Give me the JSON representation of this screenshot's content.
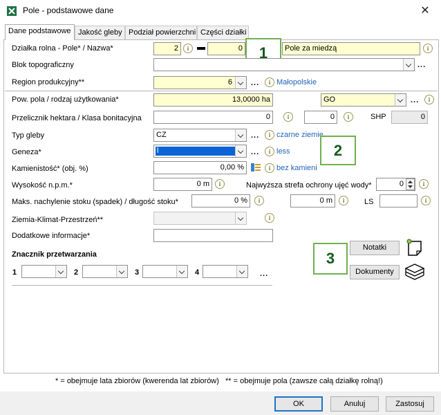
{
  "window": {
    "title": "Pole - podstawowe dane",
    "close_glyph": "✕"
  },
  "tabs": [
    {
      "label": "Dane podstawowe",
      "active": true
    },
    {
      "label": "Jakość gleby",
      "active": false
    },
    {
      "label": "Podział powierzchni",
      "active": false
    },
    {
      "label": "Części działki",
      "active": false
    }
  ],
  "form": {
    "dzialka": {
      "label": "Działka rolna - Pole* / Nazwa*",
      "value1": "2",
      "value2": "0",
      "name_value": "Pole za miedzą"
    },
    "blok": {
      "label": "Blok topograficzny",
      "value": ""
    },
    "region": {
      "label": "Region produkcyjny**",
      "value": "6",
      "link": "Małopolskie"
    },
    "pow": {
      "label": "Pow. pola / rodzaj użytkowania*",
      "value": "13,0000 ha",
      "usage_value": "GO"
    },
    "przelicznik": {
      "label": "Przelicznik hektara / Klasa bonitacyjna",
      "value1": "0",
      "value2": "0",
      "shp_label": "SHP",
      "shp_value": "0"
    },
    "typ_gleby": {
      "label": "Typ gleby",
      "value": "CZ",
      "link": "czarne ziemie"
    },
    "geneza": {
      "label": "Geneza*",
      "value": "l",
      "link": "less"
    },
    "kamienistosc": {
      "label": "Kamienistość* (obj. %)",
      "value": "0,00 %",
      "link": "bez kamieni"
    },
    "wysokosc": {
      "label": "Wysokość n.p.m.*",
      "value": "0 m"
    },
    "strefa": {
      "label": "Najwyższa strefa ochrony ujęć wody*",
      "value": "0"
    },
    "nachylenie": {
      "label": "Maks. nachylenie stoku (spadek) / długość stoku*",
      "value1": "0 %",
      "value2": "0 m",
      "ls_label": "LS",
      "ls_value": ""
    },
    "zkp": {
      "label": "Ziemia-Klimat-Przestrzeń**",
      "value": ""
    },
    "dodatkowe": {
      "label": "Dodatkowe informacje*",
      "value": ""
    }
  },
  "znacznik": {
    "title": "Znacznik przetwarzania",
    "slots": [
      "1",
      "2",
      "3",
      "4"
    ]
  },
  "common": {
    "dots": "...",
    "info_glyph": "i"
  },
  "callouts": [
    "1",
    "2",
    "3"
  ],
  "side_buttons": {
    "notatki": "Notatki",
    "dokumenty": "Dokumenty"
  },
  "footnote": {
    "left": "* = obejmuje lata zbiorów (kwerenda lat zbiorów)",
    "right": "** = obejmuje pola (zawsze całą działkę rolną!)"
  },
  "buttons": {
    "ok": "OK",
    "cancel": "Anuluj",
    "apply": "Zastosuj"
  },
  "colors": {
    "accent": "#1b74c8",
    "link": "#1f63b8",
    "yellow_field": "#fefed0",
    "callout_border": "#6fb04e"
  }
}
